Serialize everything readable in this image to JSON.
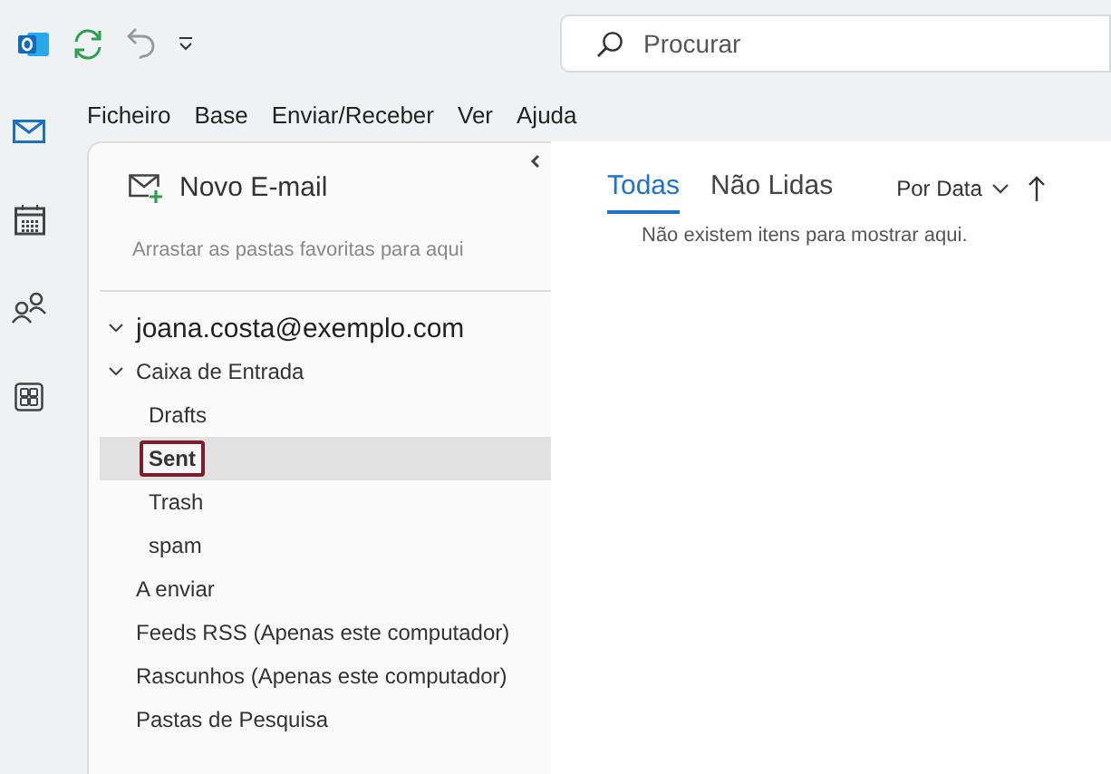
{
  "search": {
    "placeholder": "Procurar"
  },
  "menu": [
    "Ficheiro",
    "Base",
    "Enviar/Receber",
    "Ver",
    "Ajuda"
  ],
  "nav": [
    {
      "kind": "mail",
      "selected": true
    },
    {
      "kind": "calendar",
      "selected": false
    },
    {
      "kind": "people",
      "selected": false
    },
    {
      "kind": "apps",
      "selected": false
    }
  ],
  "new_email": {
    "label": "Novo E-mail"
  },
  "favorites_hint": "Arrastar as pastas favoritas para aqui",
  "folders": [
    {
      "label": "joana.costa@exemplo.com",
      "selected": false,
      "expanded": true,
      "children": [
        {
          "label": "Caixa de Entrada",
          "selected": false,
          "expanded": true,
          "children": [
            {
              "label": "Drafts",
              "selected": false
            },
            {
              "label": "Sent",
              "selected": true
            },
            {
              "label": "Trash",
              "selected": false
            },
            {
              "label": "spam",
              "selected": false
            }
          ]
        },
        {
          "label": "A enviar",
          "selected": false
        },
        {
          "label": "Feeds RSS (Apenas este computador)",
          "selected": false
        },
        {
          "label": "Rascunhos (Apenas este computador)",
          "selected": false
        },
        {
          "label": "Pastas de Pesquisa",
          "selected": false
        }
      ]
    }
  ],
  "message_list": {
    "tabs": [
      {
        "label": "Todas",
        "selected": true
      },
      {
        "label": "Não Lidas",
        "selected": false
      }
    ],
    "sort": "Por Data",
    "empty_text": "Não existem itens para mostrar aqui."
  }
}
